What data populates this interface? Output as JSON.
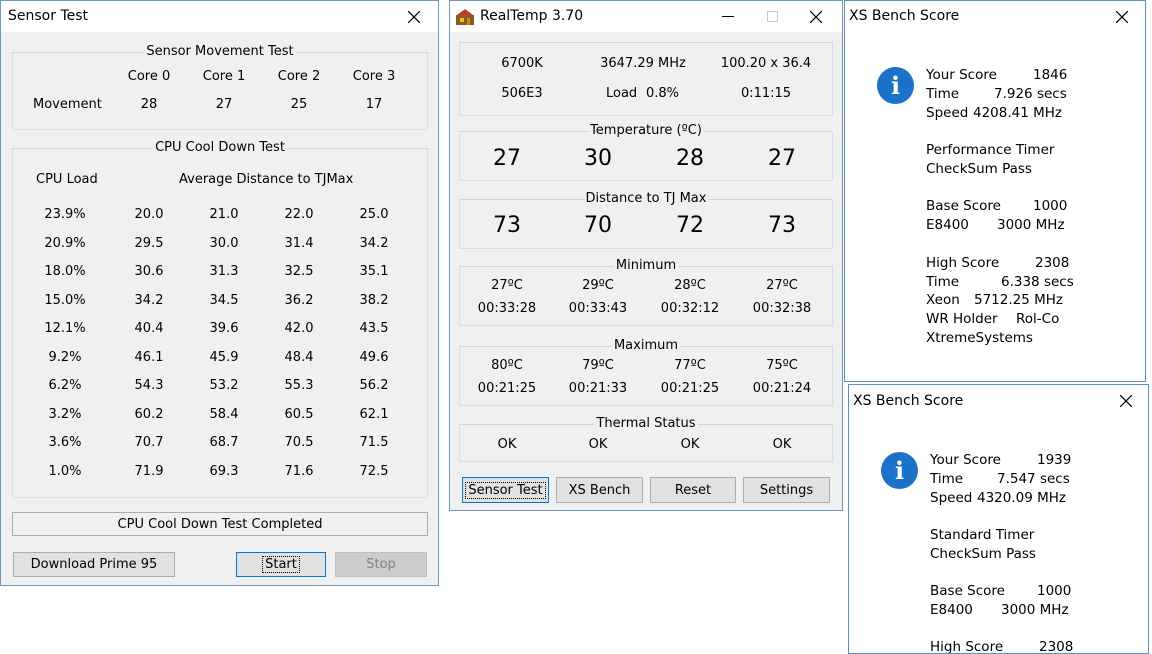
{
  "sensor_test": {
    "title": "Sensor Test",
    "movement": {
      "group_title": "Sensor Movement Test",
      "cores": [
        "Core 0",
        "Core 1",
        "Core 2",
        "Core 3"
      ],
      "row_label": "Movement",
      "values": [
        "28",
        "27",
        "25",
        "17"
      ]
    },
    "cooldown": {
      "group_title": "CPU Cool Down Test",
      "col1_header": "CPU Load",
      "col2_header": "Average Distance to TJMax",
      "rows": [
        {
          "load": "23.9%",
          "v": [
            "20.0",
            "21.0",
            "22.0",
            "25.0"
          ]
        },
        {
          "load": "20.9%",
          "v": [
            "29.5",
            "30.0",
            "31.4",
            "34.2"
          ]
        },
        {
          "load": "18.0%",
          "v": [
            "30.6",
            "31.3",
            "32.5",
            "35.1"
          ]
        },
        {
          "load": "15.0%",
          "v": [
            "34.2",
            "34.5",
            "36.2",
            "38.2"
          ]
        },
        {
          "load": "12.1%",
          "v": [
            "40.4",
            "39.6",
            "42.0",
            "43.5"
          ]
        },
        {
          "load": "9.2%",
          "v": [
            "46.1",
            "45.9",
            "48.4",
            "49.6"
          ]
        },
        {
          "load": "6.2%",
          "v": [
            "54.3",
            "53.2",
            "55.3",
            "56.2"
          ]
        },
        {
          "load": "3.2%",
          "v": [
            "60.2",
            "58.4",
            "60.5",
            "62.1"
          ]
        },
        {
          "load": "3.6%",
          "v": [
            "70.7",
            "68.7",
            "70.5",
            "71.5"
          ]
        },
        {
          "load": "1.0%",
          "v": [
            "71.9",
            "69.3",
            "71.6",
            "72.5"
          ]
        }
      ]
    },
    "status": "CPU Cool Down Test Completed",
    "buttons": {
      "download": "Download Prime 95",
      "start": "Start",
      "stop": "Stop"
    }
  },
  "realtemp": {
    "title": "RealTemp 3.70",
    "info": {
      "cpu": "6700K",
      "mhz": "3647.29 MHz",
      "mult": "100.20 x 36.4",
      "stepping": "506E3",
      "load_label": "Load",
      "load_value": "0.8%",
      "time": "0:11:15"
    },
    "temperature": {
      "title": "Temperature (ºC)",
      "values": [
        "27",
        "30",
        "28",
        "27"
      ]
    },
    "distance": {
      "title": "Distance to TJ Max",
      "values": [
        "73",
        "70",
        "72",
        "73"
      ]
    },
    "minimum": {
      "title": "Minimum",
      "temps": [
        "27ºC",
        "29ºC",
        "28ºC",
        "27ºC"
      ],
      "times": [
        "00:33:28",
        "00:33:43",
        "00:32:12",
        "00:32:38"
      ]
    },
    "maximum": {
      "title": "Maximum",
      "temps": [
        "80ºC",
        "79ºC",
        "77ºC",
        "75ºC"
      ],
      "times": [
        "00:21:25",
        "00:21:33",
        "00:21:25",
        "00:21:24"
      ]
    },
    "thermal": {
      "title": "Thermal Status",
      "values": [
        "OK",
        "OK",
        "OK",
        "OK"
      ]
    },
    "buttons": {
      "sensor_test": "Sensor Test",
      "xs_bench": "XS Bench",
      "reset": "Reset",
      "settings": "Settings"
    }
  },
  "xs_bench_1": {
    "title": "XS Bench Score",
    "your_score_label": "Your Score",
    "your_score": "1846",
    "time_label": "Time",
    "time": "7.926 secs",
    "speed_label": "Speed",
    "speed": "4208.41 MHz",
    "timer": "Performance Timer",
    "checksum": "CheckSum Pass",
    "base_score_label": "Base Score",
    "base_score": "1000",
    "base_cpu": "E8400",
    "base_speed": "3000 MHz",
    "high_score_label": "High Score",
    "high_score": "2308",
    "high_time_label": "Time",
    "high_time": "6.338 secs",
    "high_cpu": "Xeon",
    "high_speed": "5712.25 MHz",
    "holder_label": "WR Holder",
    "holder": "Rol-Co",
    "site": "XtremeSystems"
  },
  "xs_bench_2": {
    "title": "XS Bench Score",
    "your_score_label": "Your Score",
    "your_score": "1939",
    "time_label": "Time",
    "time": "7.547 secs",
    "speed_label": "Speed",
    "speed": "4320.09 MHz",
    "timer": "Standard Timer",
    "checksum": "CheckSum Pass",
    "base_score_label": "Base Score",
    "base_score": "1000",
    "base_cpu": "E8400",
    "base_speed": "3000 MHz",
    "high_score_label": "High Score",
    "high_score": "2308"
  }
}
